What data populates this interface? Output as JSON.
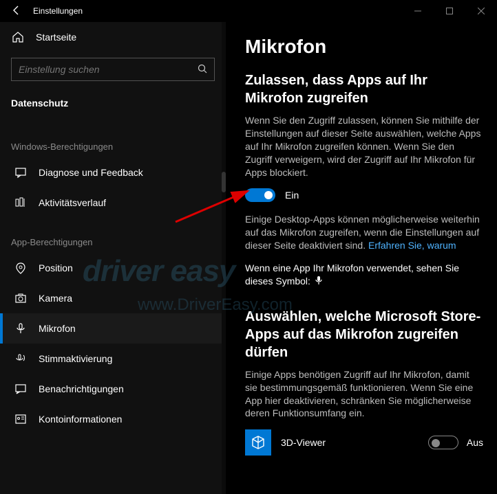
{
  "titlebar": {
    "title": "Einstellungen"
  },
  "sidebar": {
    "home": "Startseite",
    "search_placeholder": "Einstellung suchen",
    "category": "Datenschutz",
    "section_windows": "Windows-Berechtigungen",
    "section_app": "App-Berechtigungen",
    "items_windows": [
      {
        "label": "Diagnose und Feedback"
      },
      {
        "label": "Aktivitätsverlauf"
      }
    ],
    "items_app": [
      {
        "label": "Position"
      },
      {
        "label": "Kamera"
      },
      {
        "label": "Mikrofon"
      },
      {
        "label": "Stimmaktivierung"
      },
      {
        "label": "Benachrichtigungen"
      },
      {
        "label": "Kontoinformationen"
      }
    ]
  },
  "main": {
    "page_title": "Mikrofon",
    "section1_title": "Zulassen, dass Apps auf Ihr Mikrofon zugreifen",
    "section1_body": "Wenn Sie den Zugriff zulassen, können Sie mithilfe der Einstellungen auf dieser Seite auswählen, welche Apps auf Ihr Mikrofon zugreifen können. Wenn Sie den Zugriff verweigern, wird der Zugriff auf Ihr Mikrofon für Apps blockiert.",
    "toggle1_label": "Ein",
    "desktop_note_pre": "Einige Desktop-Apps können möglicherweise weiterhin auf das Mikrofon zugreifen, wenn die Einstellungen auf dieser Seite deaktiviert sind. ",
    "desktop_note_link": "Erfahren Sie, warum",
    "inuse_note": "Wenn eine App Ihr Mikrofon verwendet, sehen Sie dieses Symbol:",
    "section2_title": "Auswählen, welche Microsoft Store-Apps auf das Mikrofon zugreifen dürfen",
    "section2_body": "Einige Apps benötigen Zugriff auf Ihr Mikrofon, damit sie bestimmungsgemäß funktionieren. Wenn Sie eine App hier deaktivieren, schränken Sie möglicherweise deren Funktionsumfang ein.",
    "app1_name": "3D-Viewer",
    "app1_state": "Aus"
  },
  "watermark": {
    "line1": "driver easy",
    "line2": "www.DriverEasy.com"
  }
}
